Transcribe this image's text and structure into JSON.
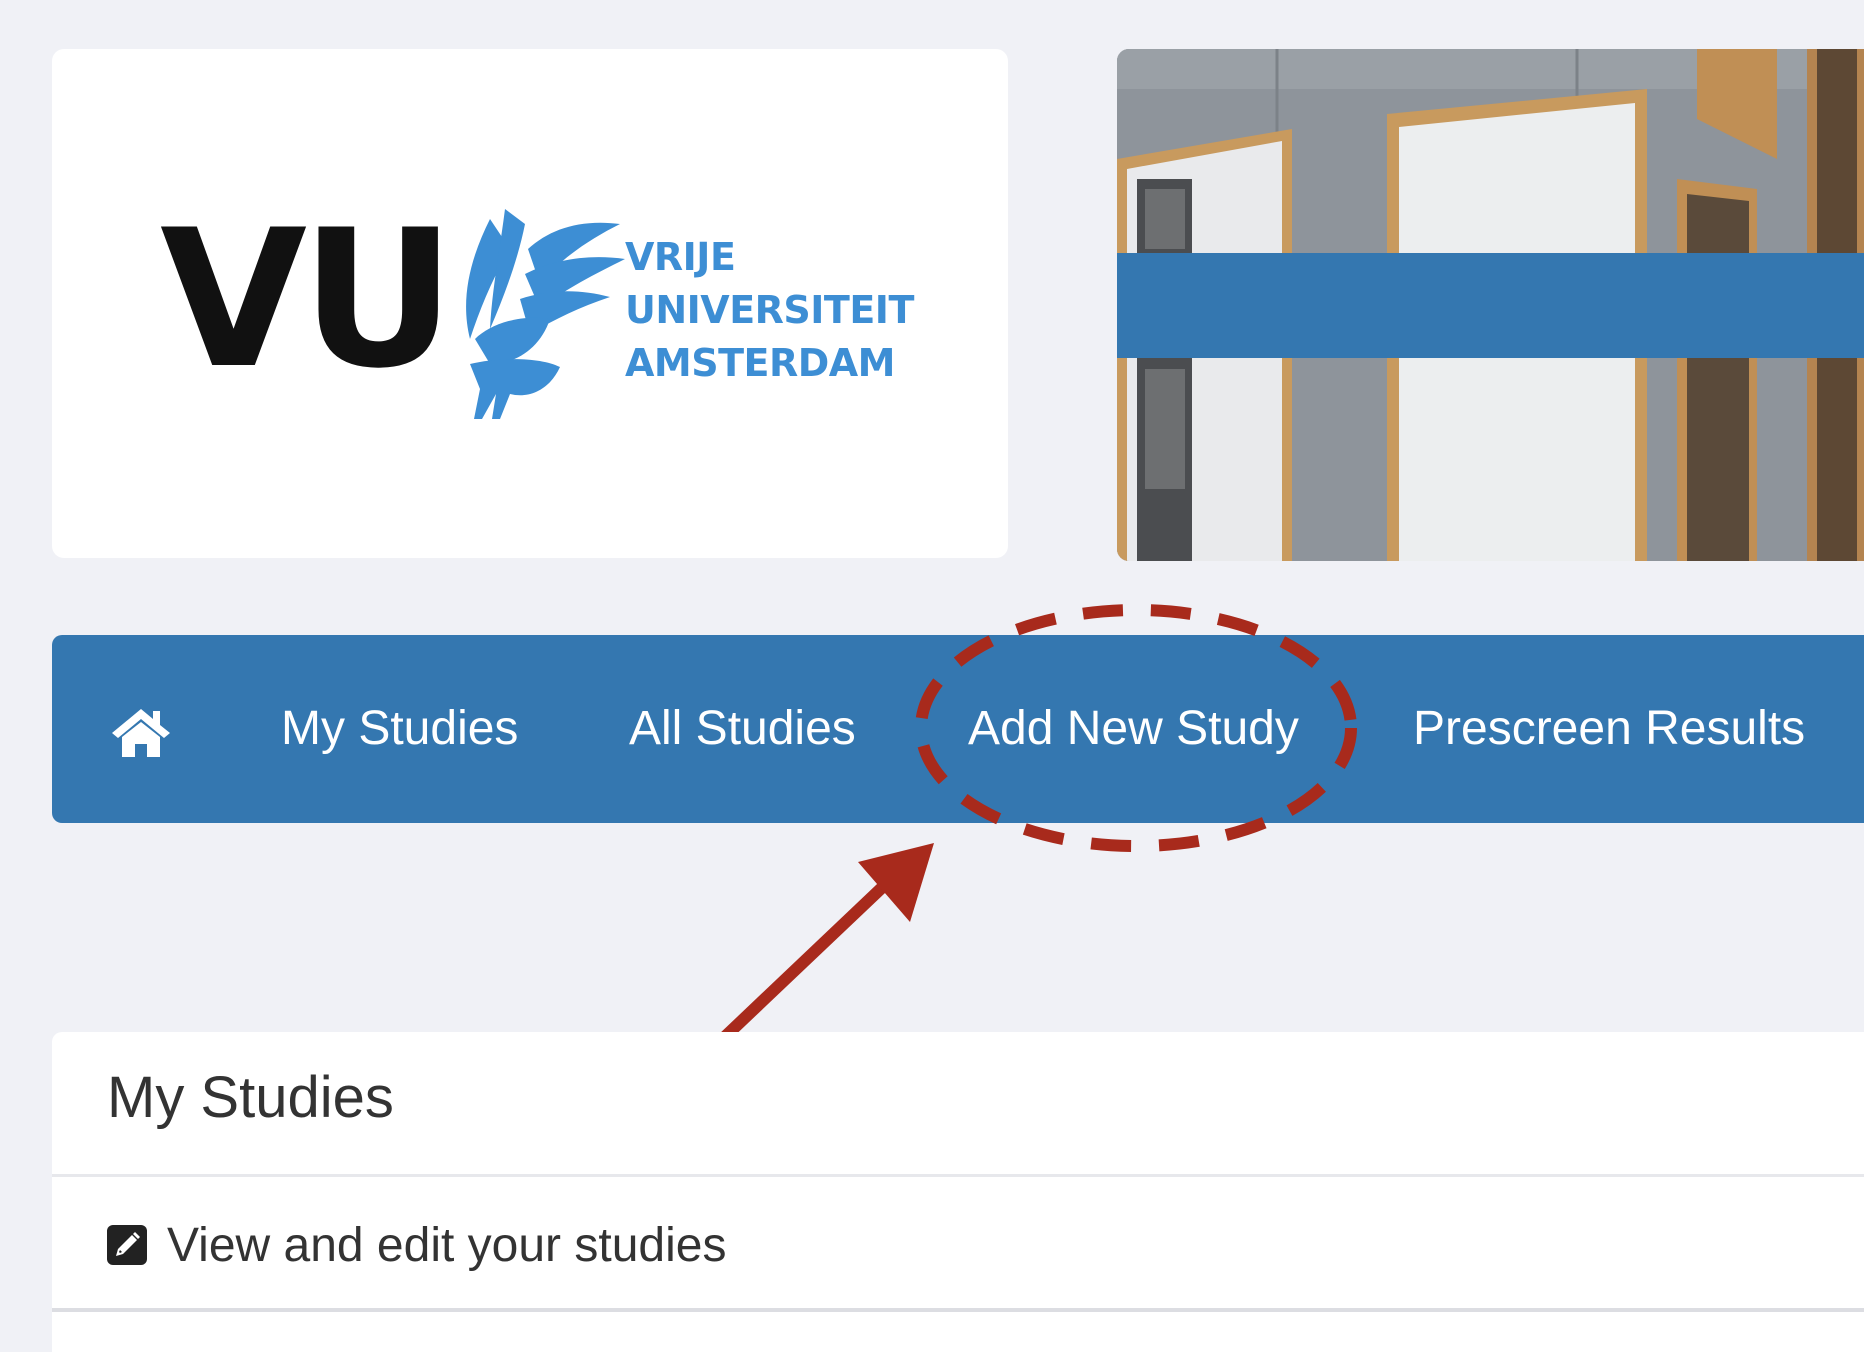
{
  "logo": {
    "mark": "VU",
    "words": [
      "VRIJE",
      "UNIVERSITEIT",
      "AMSTERDAM"
    ],
    "color": "#3d8ed4"
  },
  "nav": {
    "home_icon": "home-icon",
    "items": [
      {
        "label": "My Studies"
      },
      {
        "label": "All Studies"
      },
      {
        "label": "Add New Study"
      },
      {
        "label": "Prescreen Results"
      }
    ],
    "background": "#3477b0"
  },
  "annotation": {
    "color": "#a82a1c",
    "target": "Add New Study"
  },
  "panel": {
    "title": "My Studies",
    "row_icon": "edit-icon",
    "row_label": "View and edit your studies"
  }
}
